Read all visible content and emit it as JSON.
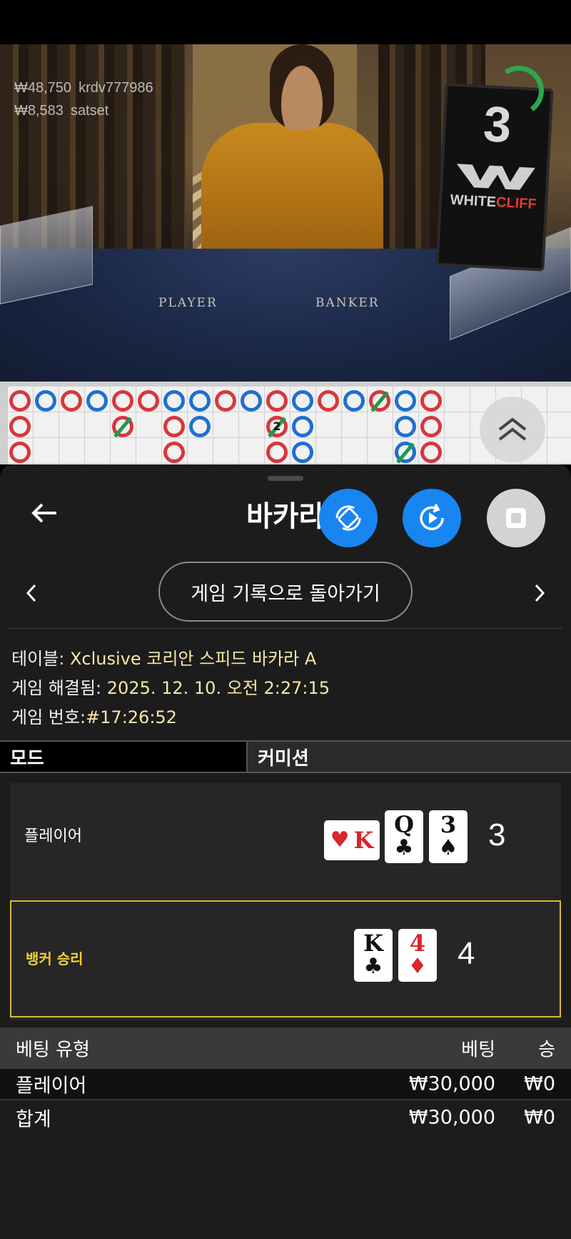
{
  "video": {
    "overlay_wins": [
      {
        "amount": "₩48,750",
        "user": "krdv777986"
      },
      {
        "amount": "₩8,583",
        "user": "satset"
      }
    ],
    "countdown": "3",
    "brand_white": "WHITE",
    "brand_cliff": "CLIFF",
    "felt_player": "PLAYER",
    "felt_banker": "BANKER"
  },
  "road": {
    "tie_number": "2",
    "colors": {
      "player": "#1f6fd1",
      "banker": "#d8373c",
      "tie": "#1d9a4b"
    }
  },
  "header": {
    "title": "바카라",
    "back_icon": "arrow-left-icon",
    "buttons": [
      {
        "name": "rotate-view-button",
        "icon": "rotate-icon",
        "color": "#1985f0"
      },
      {
        "name": "replay-button",
        "icon": "replay-icon",
        "color": "#1985f0"
      },
      {
        "name": "stop-button",
        "icon": "stop-icon",
        "color": "#d3d3d3"
      }
    ]
  },
  "nav": {
    "back_to_history": "게임 기록으로 돌아가기",
    "prev_icon": "chevron-left-icon",
    "next_icon": "chevron-right-icon"
  },
  "info": {
    "table_label": "테이블:",
    "table_value": "Xclusive 코리안 스피드 바카라 A",
    "resolved_label": "게임 해결됨:",
    "resolved_value": "2025. 12. 10. 오전 2:27:15",
    "number_label": "게임 번호:",
    "number_value": "#17:26:52"
  },
  "tabs": {
    "mode": "모드",
    "commission": "커미션"
  },
  "result": {
    "player": {
      "label": "플레이어",
      "total": "3",
      "cards": [
        {
          "rank": "K",
          "suit": "♥",
          "red": true,
          "side": true
        },
        {
          "rank": "Q",
          "suit": "♣",
          "red": false
        },
        {
          "rank": "3",
          "suit": "♠",
          "red": false
        }
      ]
    },
    "banker": {
      "label": "뱅커 승리",
      "total": "4",
      "cards": [
        {
          "rank": "K",
          "suit": "♣",
          "red": false
        },
        {
          "rank": "4",
          "suit": "♦",
          "red": true
        }
      ]
    }
  },
  "bets": {
    "headers": {
      "type": "베팅 유형",
      "bet": "베팅",
      "win": "승"
    },
    "rows": [
      {
        "type": "플레이어",
        "bet": "₩30,000",
        "win": "₩0"
      }
    ],
    "total": {
      "type": "합계",
      "bet": "₩30,000",
      "win": "₩0"
    }
  }
}
